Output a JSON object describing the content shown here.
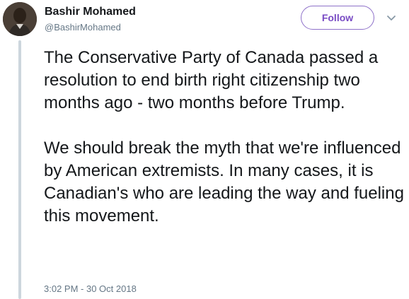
{
  "author": {
    "name": "Bashir Mohamed",
    "handle": "@BashirMohamed",
    "avatar_icon": "profile-photo"
  },
  "actions": {
    "follow_label": "Follow",
    "more_icon": "chevron-down-icon"
  },
  "tweet": {
    "paragraphs": [
      "The Conservative Party of Canada passed a resolution to end birth right citizenship two months ago - two months before Trump.",
      "We should break the myth that we're influenced by American extremists. In many cases, it is Canadian's who are leading the way and fueling this movement."
    ],
    "timestamp": "3:02 PM - 30 Oct 2018"
  },
  "colors": {
    "accent": "#794bc4",
    "text": "#14171a",
    "muted": "#657786",
    "thread_line": "#ccd6dd"
  }
}
